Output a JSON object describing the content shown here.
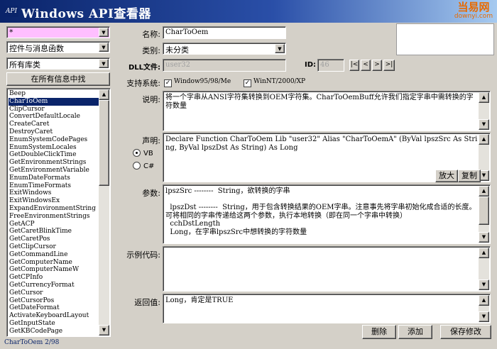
{
  "window": {
    "icon_text": "API",
    "title": "Windows API查看器",
    "watermark_top": "当易网",
    "watermark_bottom": "downyi.com"
  },
  "left": {
    "search_value": "*",
    "category_combo": "控件与消息函数",
    "library_combo": "所有库类",
    "search_all_button": "在所有信息中找",
    "functions": [
      "Beep",
      "CharToOem",
      "ClipCursor",
      "ConvertDefaultLocale",
      "CreateCaret",
      "DestroyCaret",
      "EnumSystemCodePages",
      "EnumSystemLocales",
      "GetDoubleClickTime",
      "GetEnvironmentStrings",
      "GetEnvironmentVariable",
      "EnumDateFormats",
      "EnumTimeFormats",
      "ExitWindows",
      "ExitWindowsEx",
      "ExpandEnvironmentString",
      "FreeEnvironmentStrings",
      "GetACP",
      "GetCaretBlinkTime",
      "GetCaretPos",
      "GetClipCursor",
      "GetCommandLine",
      "GetComputerName",
      "GetComputerNameW",
      "GetCPInfo",
      "GetCurrencyFormat",
      "GetCursor",
      "GetCursorPos",
      "GetDateFormat",
      "ActivateKeyboardLayout",
      "GetInputState",
      "GetKBCodePage"
    ],
    "selected_index": 1,
    "status": "CharToOem 2/98"
  },
  "details": {
    "name_label": "名称:",
    "name_value": "CharToOem",
    "type_label": "类别:",
    "type_value": "未分类",
    "dll_label": "DLL文件:",
    "dll_value": "user32",
    "id_label": "ID:",
    "id_value": "46",
    "nav": [
      "|<",
      "<",
      ">",
      ">|"
    ],
    "os_label": "支持系统:",
    "os_win9x": "Window95/98/Me",
    "os_winnt": "WinNT/2000/XP",
    "desc_label": "说明:",
    "desc_text": "将一个字串从ANSI字符集转换到OEM字符集。CharToOemBuff允许我们指定字串中需转换的字符数量",
    "decl_label": "声明:",
    "decl_text": "Declare Function CharToOem Lib \"user32\" Alias \"CharToOemA\" (ByVal lpszSrc As String, ByVal lpszDst As String) As Long",
    "lang_vb": "VB",
    "lang_cs": "C#",
    "enlarge_button": "放大",
    "copy_button": "复制",
    "params_label": "参数:",
    "params_text": "lpszSrc --------  String，欲转换的字串\n\n  lpszDst --------  String，用于包含转换结果的OEM字串。注意事先将字串初始化成合适的长度。可将相同的字串传递给这两个参数，执行本地转换（即在同一个字串中转换）\n  cchDstLength\n  Long，在字串lpszSrc中想转换的字符数量",
    "example_label": "示例代码:",
    "example_text": "",
    "return_label": "返回值:",
    "return_text": "Long，肯定是TRUE",
    "delete_button": "删除",
    "add_button": "添加",
    "save_button": "保存修改"
  }
}
